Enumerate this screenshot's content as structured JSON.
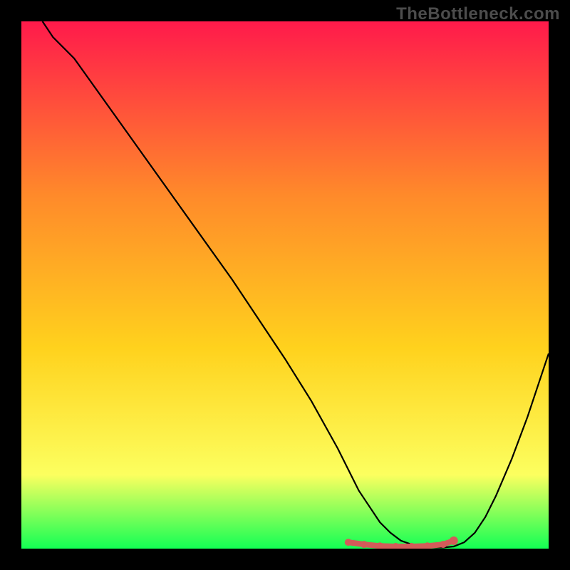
{
  "watermark": "TheBottleneck.com",
  "colors": {
    "background": "#000000",
    "gradient_top": "#ff1a4b",
    "gradient_mid1": "#ff6a30",
    "gradient_mid2": "#ffd21d",
    "gradient_mid3": "#fcff5f",
    "gradient_bottom": "#13ff54",
    "curve": "#000000",
    "marker": "#d35b59"
  },
  "chart_data": {
    "type": "line",
    "title": "",
    "xlabel": "",
    "ylabel": "",
    "xlim": [
      0,
      100
    ],
    "ylim": [
      0,
      100
    ],
    "series": [
      {
        "name": "curve",
        "x": [
          4,
          6,
          10,
          20,
          30,
          40,
          50,
          55,
          60,
          62,
          64,
          66,
          68,
          70,
          72,
          74,
          76,
          78,
          80,
          82,
          84,
          86,
          88,
          90,
          93,
          96,
          100
        ],
        "y": [
          100,
          97,
          93,
          79,
          65,
          51,
          36,
          28,
          19,
          15,
          11,
          8,
          5,
          3,
          1.5,
          0.8,
          0.4,
          0.2,
          0.2,
          0.4,
          1.2,
          3,
          6,
          10,
          17,
          25,
          37
        ]
      },
      {
        "name": "markers",
        "x": [
          62,
          65,
          68,
          71,
          74,
          77,
          80,
          82
        ],
        "y": [
          1.2,
          0.8,
          0.5,
          0.4,
          0.4,
          0.5,
          0.8,
          1.5
        ]
      }
    ]
  }
}
